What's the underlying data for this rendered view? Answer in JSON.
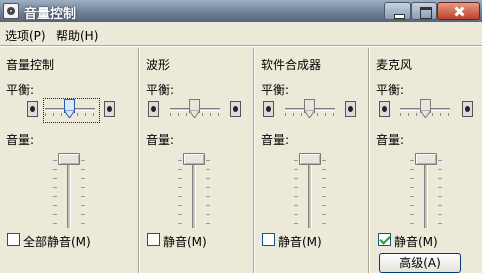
{
  "window": {
    "title": "音量控制"
  },
  "menu": {
    "options": "选项(P)",
    "help": "帮助(H)"
  },
  "panels": [
    {
      "title": "音量控制",
      "balance_label": "平衡:",
      "volume_label": "音量:",
      "mute_label": "全部静音(M)",
      "muted": false
    },
    {
      "title": "波形",
      "balance_label": "平衡:",
      "volume_label": "音量:",
      "mute_label": "静音(M)",
      "muted": false
    },
    {
      "title": "软件合成器",
      "balance_label": "平衡:",
      "volume_label": "音量:",
      "mute_label": "静音(M)",
      "muted": false
    },
    {
      "title": "麦克风",
      "balance_label": "平衡:",
      "volume_label": "音量:",
      "mute_label": "静音(M)",
      "muted": true
    }
  ],
  "advanced_button": "高级(A)",
  "icons": {
    "app": "speaker-icon",
    "speaker": "speaker-icon"
  },
  "colors": {
    "titlebar": "#6f8197",
    "window_bg": "#ece9d8",
    "close_button": "#c0412a"
  }
}
